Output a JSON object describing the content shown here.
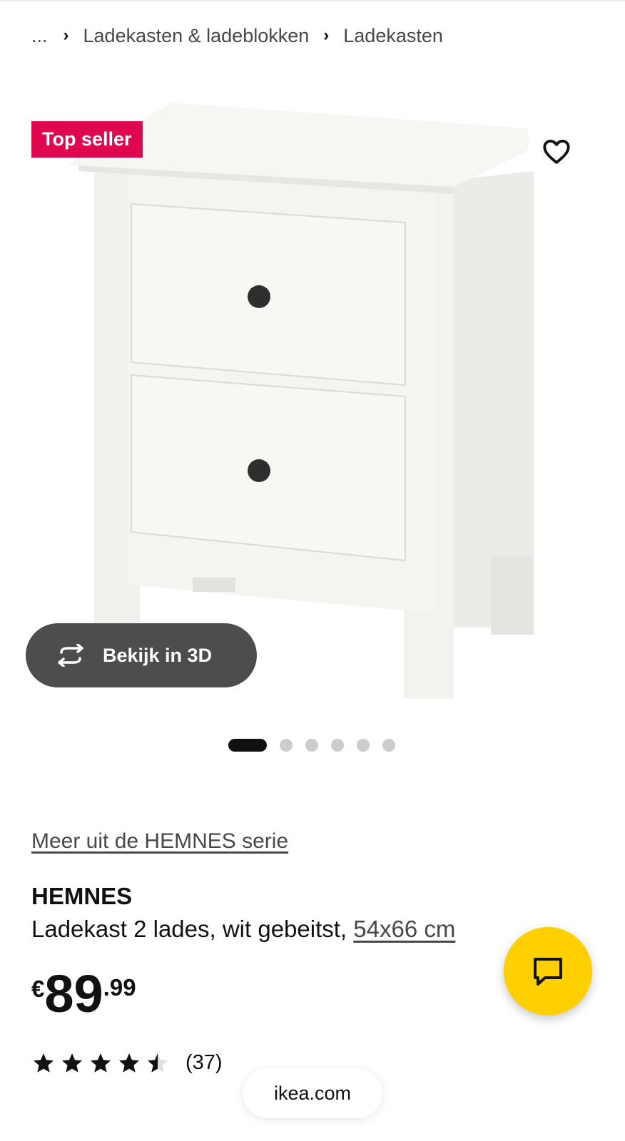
{
  "breadcrumb": {
    "ellipsis": "...",
    "items": [
      "Ladekasten & ladeblokken",
      "Ladekasten"
    ]
  },
  "gallery": {
    "badge": "Top seller",
    "view3d_label": "Bekijk in 3D",
    "image_count": 6,
    "active_index": 0
  },
  "product": {
    "series_link": "Meer uit de HEMNES serie",
    "brand": "HEMNES",
    "description": "Ladekast 2 lades, wit gebeitst,",
    "dimensions": "54x66 cm",
    "price": {
      "currency": "€",
      "integer": "89",
      "decimal": ".99"
    },
    "rating": {
      "value": 4.5,
      "max": 5,
      "count": "(37)"
    }
  },
  "browser": {
    "url": "ikea.com"
  },
  "colors": {
    "badge": "#e00751",
    "chat": "#fed000",
    "view3d": "#4d4d4d"
  },
  "icons": {
    "favourite": "heart-icon",
    "view3d": "rotate-3d-icon",
    "chat": "chat-bubble-icon",
    "star": "star-icon"
  }
}
